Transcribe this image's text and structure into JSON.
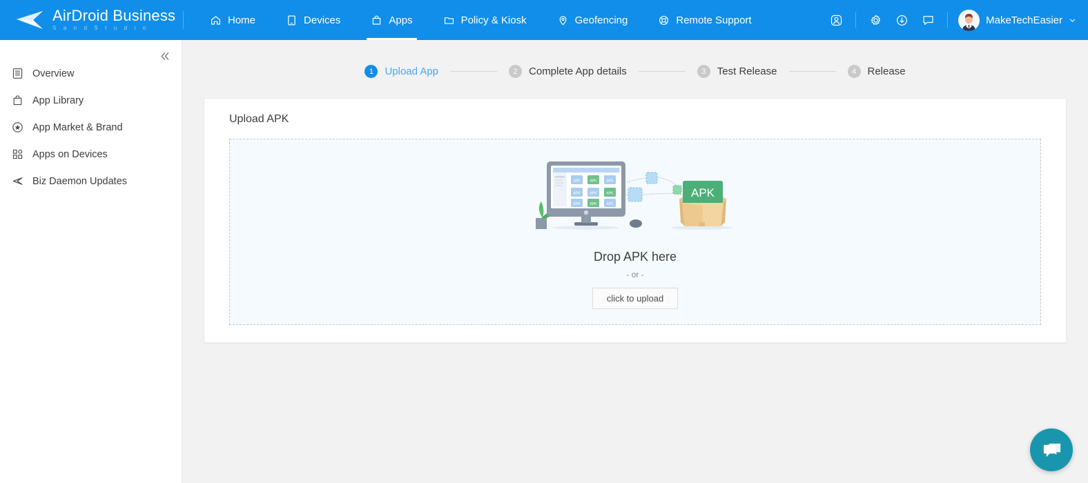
{
  "header": {
    "logo_title": "AirDroid Business",
    "logo_subtitle": "S a n d   S t u d i o",
    "logo_icon": "airdroid-arrow-logo-icon",
    "nav": [
      {
        "label": "Home",
        "icon": "home-icon",
        "active": false
      },
      {
        "label": "Devices",
        "icon": "tablet-icon",
        "active": false
      },
      {
        "label": "Apps",
        "icon": "shopping-bag-icon",
        "active": true
      },
      {
        "label": "Policy & Kiosk",
        "icon": "folder-icon",
        "active": false
      },
      {
        "label": "Geofencing",
        "icon": "map-pin-icon",
        "active": false
      },
      {
        "label": "Remote Support",
        "icon": "lifebuoy-icon",
        "active": false
      }
    ],
    "actions": [
      {
        "icon": "user-badge-icon",
        "name": "account-icon"
      },
      {
        "icon": "gear-icon",
        "name": "settings-icon"
      },
      {
        "icon": "download-icon",
        "name": "downloads-icon"
      },
      {
        "icon": "message-icon",
        "name": "messages-icon"
      }
    ],
    "user_name": "MakeTechEasier",
    "user_caret_icon": "chevron-down-icon",
    "avatar_icon": "user-avatar"
  },
  "sidebar": {
    "collapse_icon": "double-chevron-left-icon",
    "items": [
      {
        "label": "Overview",
        "icon": "document-list-icon"
      },
      {
        "label": "App Library",
        "icon": "bag-icon"
      },
      {
        "label": "App Market & Brand",
        "icon": "star-circle-icon"
      },
      {
        "label": "Apps on Devices",
        "icon": "grid-dots-icon"
      },
      {
        "label": "Biz Daemon Updates",
        "icon": "send-arrow-icon"
      }
    ]
  },
  "main": {
    "steps": [
      {
        "num": "1",
        "label": "Upload App",
        "active": true
      },
      {
        "num": "2",
        "label": "Complete App details",
        "active": false
      },
      {
        "num": "3",
        "label": "Test Release",
        "active": false
      },
      {
        "num": "4",
        "label": "Release",
        "active": false
      }
    ],
    "card_title": "Upload APK",
    "dropzone": {
      "illustration_icon": "apk-upload-illustration",
      "apk_badge_label": "APK",
      "monitor_tile_label": "APK",
      "drop_title": "Drop APK here",
      "or_text": "- or -",
      "upload_button": "click to upload"
    }
  },
  "chat": {
    "icon": "chat-bubbles-icon",
    "color": "#1996ad"
  },
  "colors": {
    "header_blue": "#108ee9",
    "accent_blue": "#4ba7f0",
    "page_bg": "#f2f2f2",
    "dropzone_bg": "#f5fafe",
    "apk_green": "#4caf78",
    "apk_blue": "#a8cdf0"
  }
}
